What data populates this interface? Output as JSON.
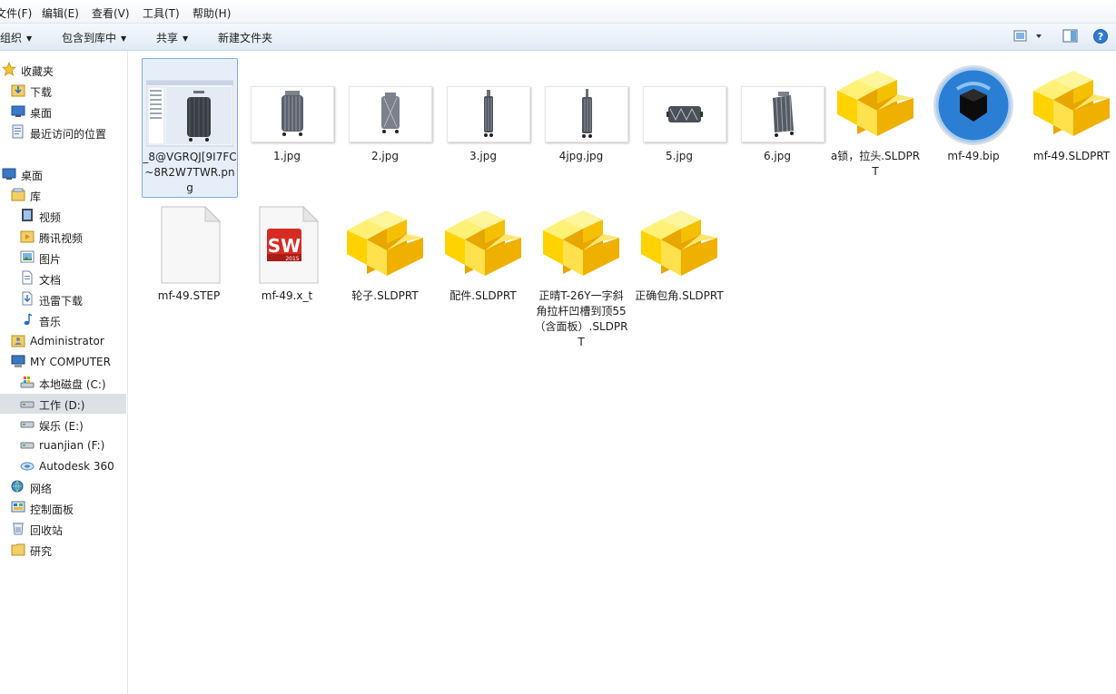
{
  "menu": {
    "file": "文件(F)",
    "edit": "编辑(E)",
    "view": "查看(V)",
    "tools": "工具(T)",
    "help": "帮助(H)"
  },
  "toolbar": {
    "organize": "组织",
    "include_in_library": "包含到库中",
    "share": "共享",
    "new_folder": "新建文件夹"
  },
  "nav": {
    "favorites": "收藏夹",
    "downloads": "下载",
    "desktop_fav": "桌面",
    "recent": "最近访问的位置",
    "desktop": "桌面",
    "libraries": "库",
    "videos": "视频",
    "tencent_video": "腾讯视频",
    "pictures": "图片",
    "documents": "文档",
    "thunder": "迅雷下载",
    "music": "音乐",
    "administrator": "Administrator",
    "computer": "MY COMPUTER",
    "drive_c": "本地磁盘 (C:)",
    "drive_d": "工作 (D:)",
    "drive_e": "娱乐 (E:)",
    "drive_f": "ruanjian (F:)",
    "autodesk": "Autodesk 360",
    "network": "网络",
    "control_panel": "控制面板",
    "recycle_bin": "回收站",
    "research": "研究"
  },
  "files": [
    {
      "name": "_8@VGRQJ[9I7FC~8R2W7TWR.png",
      "type": "png-screenshot",
      "selected": true
    },
    {
      "name": "1.jpg",
      "type": "jpg"
    },
    {
      "name": "2.jpg",
      "type": "jpg"
    },
    {
      "name": "3.jpg",
      "type": "jpg"
    },
    {
      "name": "4jpg.jpg",
      "type": "jpg"
    },
    {
      "name": "5.jpg",
      "type": "jpg"
    },
    {
      "name": "6.jpg",
      "type": "jpg"
    },
    {
      "name": "a锁，拉头.SLDPRT",
      "type": "solidworks-part-icon"
    },
    {
      "name": "mf-49.bip",
      "type": "keyshot-icon"
    },
    {
      "name": "mf-49.SLDPRT",
      "type": "solidworks-part-icon"
    },
    {
      "name": "mf-49.STEP",
      "type": "blank-document-icon"
    },
    {
      "name": "mf-49.x_t",
      "type": "solidworks-2015-icon"
    },
    {
      "name": "轮子.SLDPRT",
      "type": "solidworks-part-icon"
    },
    {
      "name": "配件.SLDPRT",
      "type": "solidworks-part-icon"
    },
    {
      "name": "正晴T-26Y一字斜角拉杆凹槽到顶55（含面板）.SLDPRT",
      "type": "solidworks-part-icon"
    },
    {
      "name": "正确包角.SLDPRT",
      "type": "solidworks-part-icon"
    }
  ],
  "sw_badge": "SW",
  "sw_year": "2015",
  "colors": {
    "toolbar_bg": "#e0eaf5",
    "selection_border": "#84acdd",
    "selection_bg": "#e6eff9",
    "nav_selected_bg": "#dde1e6",
    "part_icon_yellow": "#ffd800",
    "keyshot_blue": "#2a7fd4",
    "sw_red": "#d62a22"
  }
}
